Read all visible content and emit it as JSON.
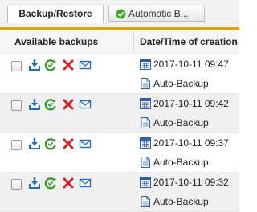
{
  "tabs": [
    {
      "label": "Backup/Restore",
      "active": true
    },
    {
      "label": "Automatic B...",
      "active": false,
      "icon": "check-circle-icon"
    }
  ],
  "table": {
    "columns": [
      "Available backups",
      "Date/Time of creation"
    ],
    "rows": [
      {
        "datetime": "2017-10-11 09:47",
        "name": "Auto-Backup"
      },
      {
        "datetime": "2017-10-11 09:42",
        "name": "Auto-Backup"
      },
      {
        "datetime": "2017-10-11 09:37",
        "name": "Auto-Backup"
      },
      {
        "datetime": "2017-10-11 09:32",
        "name": "Auto-Backup"
      }
    ],
    "row_actions": [
      "download-icon",
      "restore-icon",
      "delete-icon",
      "mail-icon"
    ]
  },
  "colors": {
    "accent": "#e3a400",
    "download": "#1f6fb5",
    "restore": "#3a9a2b",
    "delete": "#d42020",
    "mail": "#2a6fc2"
  }
}
